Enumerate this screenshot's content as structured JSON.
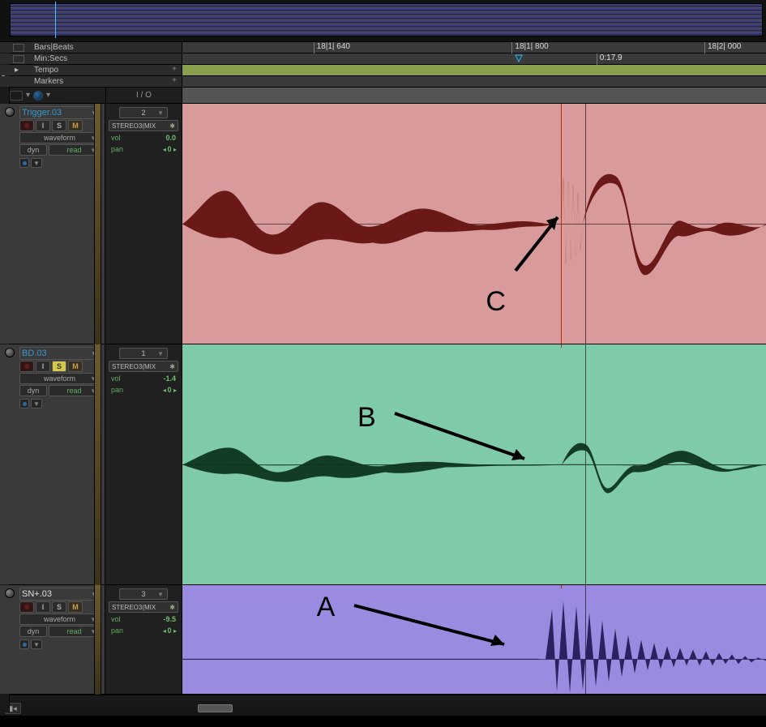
{
  "rulers": {
    "bars_beats": {
      "label": "Bars|Beats",
      "ticks": [
        "18|1| 640",
        "18|1| 800",
        "18|2| 000"
      ]
    },
    "min_secs": {
      "label": "Min:Secs",
      "cursor_time": "0:17.9"
    },
    "tempo": {
      "label": "Tempo"
    },
    "markers": {
      "label": "Markers"
    }
  },
  "header": {
    "io_label": "I / O"
  },
  "tracks": [
    {
      "name": "Trigger.03",
      "name_blue": true,
      "buttons": {
        "I": "I",
        "S": "S",
        "M": "M",
        "S_on": false
      },
      "view": "waveform",
      "dyn": "dyn",
      "auto": "read",
      "io": {
        "insert": "2",
        "output": "STEREO3(MIX",
        "vol": "0.0",
        "pan": "0"
      },
      "color": "red"
    },
    {
      "name": "BD.03",
      "name_blue": true,
      "buttons": {
        "I": "I",
        "S": "S",
        "M": "M",
        "S_on": true
      },
      "view": "waveform",
      "dyn": "dyn",
      "auto": "read",
      "io": {
        "insert": "1",
        "output": "STEREO3(MIX",
        "vol": "-1.4",
        "pan": "0"
      },
      "color": "green"
    },
    {
      "name": "SN+.03",
      "name_blue": false,
      "buttons": {
        "I": "I",
        "S": "S",
        "M": "M",
        "S_on": false
      },
      "view": "waveform",
      "dyn": "dyn",
      "auto": "read",
      "io": {
        "insert": "3",
        "output": "STEREO3(MIX",
        "vol": "-9.5",
        "pan": "0"
      },
      "color": "purple"
    }
  ],
  "annotations": {
    "A": "A",
    "B": "B",
    "C": "C"
  },
  "io_kv": {
    "vol": "vol",
    "pan": "pan"
  }
}
